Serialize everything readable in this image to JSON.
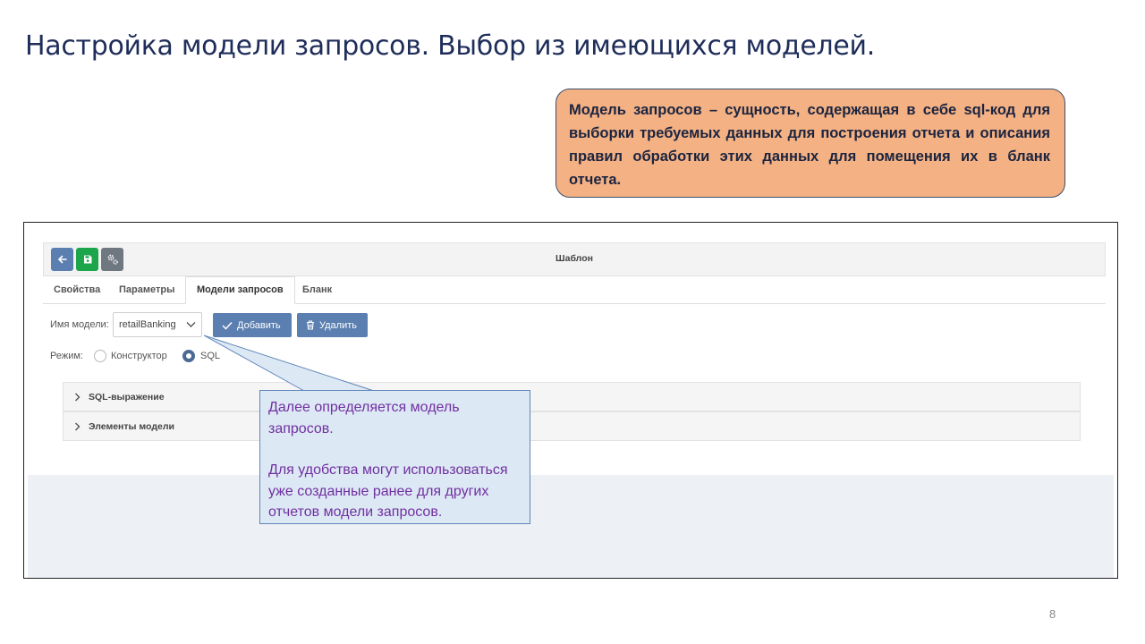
{
  "slide": {
    "title": "Настройка модели запросов. Выбор из имеющихся моделей.",
    "definition": "Модель запросов – сущность, содержащая в себе sql-код для выборки требуемых данных для построения отчета и описания правил обработки этих данных для помещения их в бланк отчета.",
    "page_number": "8"
  },
  "toolbar": {
    "title": "Шаблон",
    "back_icon": "arrow-left-icon",
    "save_icon": "floppy-disk-icon",
    "settings_icon": "gears-icon"
  },
  "tabs": [
    {
      "label": "Свойства"
    },
    {
      "label": "Параметры"
    },
    {
      "label": "Модели запросов",
      "active": true
    },
    {
      "label": "Бланк"
    }
  ],
  "model": {
    "name_label": "Имя модели:",
    "selected": "retailBanking",
    "add_label": "Добавить",
    "delete_label": "Удалить"
  },
  "mode": {
    "label": "Режим:",
    "options": [
      {
        "label": "Конструктор",
        "checked": false
      },
      {
        "label": "SQL",
        "checked": true
      }
    ]
  },
  "accordion": [
    {
      "label": "SQL-выражение"
    },
    {
      "label": "Элементы модели"
    }
  ],
  "callout": {
    "line1": "Далее определяется модель запросов.",
    "line2": "Для удобства могут использоваться уже созданные ранее для других отчетов модели запросов."
  },
  "colors": {
    "title": "#1f2d5a",
    "definition_bg": "#f4b183",
    "primary_button": "#5b7fb0",
    "save_button": "#1ca54a",
    "callout_bg": "#dde8f5",
    "callout_text": "#7030a0"
  }
}
